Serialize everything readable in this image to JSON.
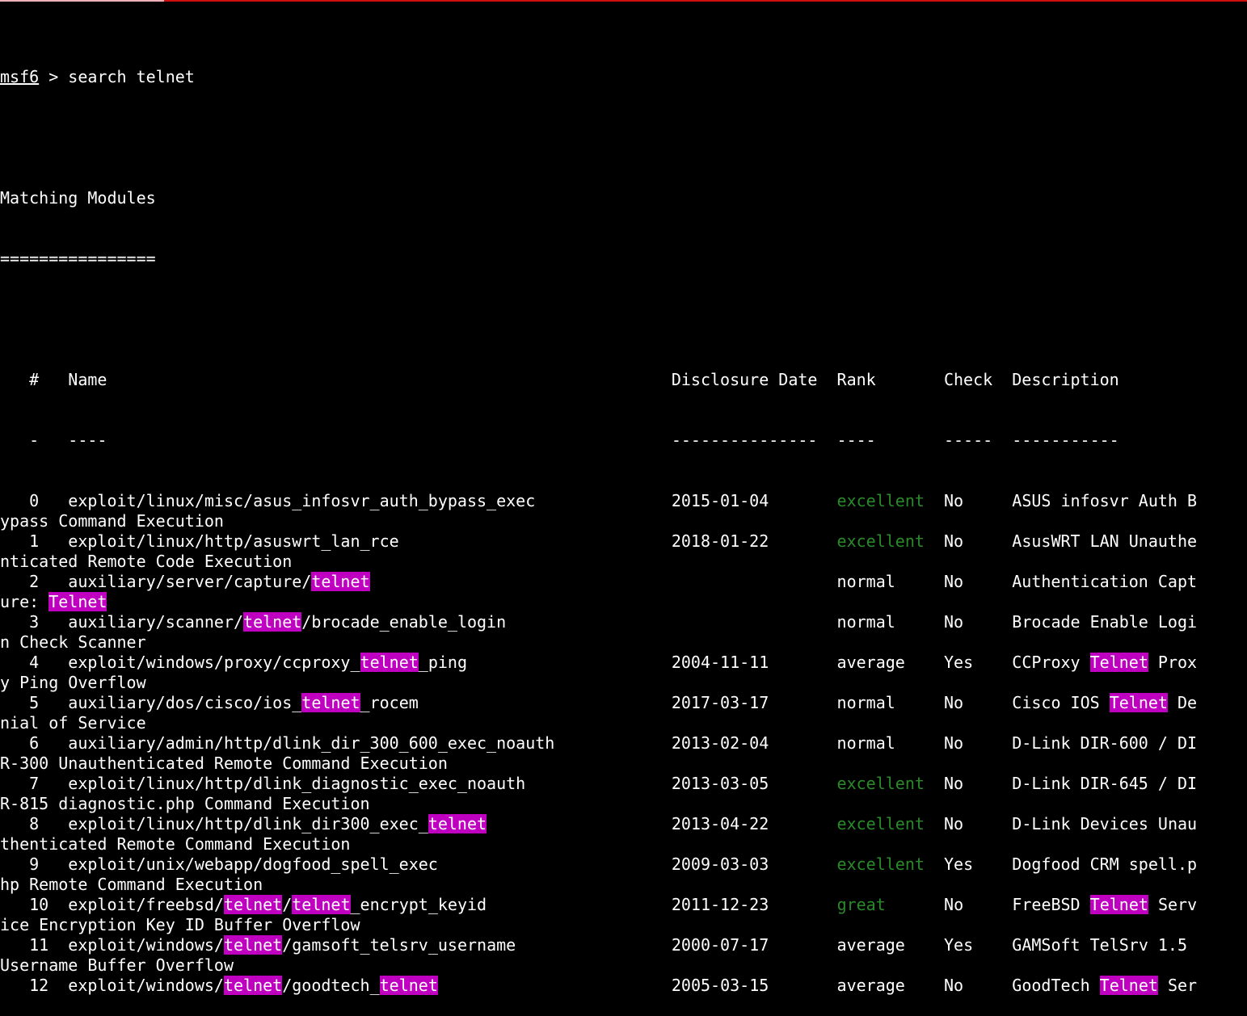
{
  "prompt": {
    "context": "msf6",
    "separator": " > ",
    "command": "search telnet"
  },
  "heading": {
    "title": "Matching Modules",
    "underline": "================"
  },
  "highlight_term": "telnet",
  "rank_green": [
    "excellent",
    "great"
  ],
  "colors": {
    "background": "#000000",
    "text": "#ffffff",
    "highlight_bg": "#c000c0",
    "rank_good": "#2a8a2a"
  },
  "header_line": "   #   Name                                                          Disclosure Date  Rank       Check  Description",
  "dash_line": "   -   ----                                                          ---------------  ----       -----  -----------",
  "rows": [
    {
      "id": 0,
      "rank": "excellent",
      "line1": "   0   exploit/linux/misc/asus_infosvr_auth_bypass_exec              2015-01-04       excellent  No     ASUS infosvr Auth B",
      "line2": "ypass Command Execution"
    },
    {
      "id": 1,
      "rank": "excellent",
      "line1": "   1   exploit/linux/http/asuswrt_lan_rce                            2018-01-22       excellent  No     AsusWRT LAN Unauthe",
      "line2": "nticated Remote Code Execution"
    },
    {
      "id": 2,
      "rank": "normal",
      "line1": "   2   auxiliary/server/capture/telnet                                                normal     No     Authentication Capt",
      "line2": "ure: Telnet"
    },
    {
      "id": 3,
      "rank": "normal",
      "line1": "   3   auxiliary/scanner/telnet/brocade_enable_login                                  normal     No     Brocade Enable Logi",
      "line2": "n Check Scanner"
    },
    {
      "id": 4,
      "rank": "average",
      "line1": "   4   exploit/windows/proxy/ccproxy_telnet_ping                     2004-11-11       average    Yes    CCProxy Telnet Prox",
      "line2": "y Ping Overflow"
    },
    {
      "id": 5,
      "rank": "normal",
      "line1": "   5   auxiliary/dos/cisco/ios_telnet_rocem                          2017-03-17       normal     No     Cisco IOS Telnet De",
      "line2": "nial of Service"
    },
    {
      "id": 6,
      "rank": "normal",
      "line1": "   6   auxiliary/admin/http/dlink_dir_300_600_exec_noauth            2013-02-04       normal     No     D-Link DIR-600 / DI",
      "line2": "R-300 Unauthenticated Remote Command Execution"
    },
    {
      "id": 7,
      "rank": "excellent",
      "line1": "   7   exploit/linux/http/dlink_diagnostic_exec_noauth               2013-03-05       excellent  No     D-Link DIR-645 / DI",
      "line2": "R-815 diagnostic.php Command Execution"
    },
    {
      "id": 8,
      "rank": "excellent",
      "line1": "   8   exploit/linux/http/dlink_dir300_exec_telnet                   2013-04-22       excellent  No     D-Link Devices Unau",
      "line2": "thenticated Remote Command Execution"
    },
    {
      "id": 9,
      "rank": "excellent",
      "line1": "   9   exploit/unix/webapp/dogfood_spell_exec                        2009-03-03       excellent  Yes    Dogfood CRM spell.p",
      "line2": "hp Remote Command Execution"
    },
    {
      "id": 10,
      "rank": "great",
      "line1": "   10  exploit/freebsd/telnet/telnet_encrypt_keyid                   2011-12-23       great      No     FreeBSD Telnet Serv",
      "line2": "ice Encryption Key ID Buffer Overflow"
    },
    {
      "id": 11,
      "rank": "average",
      "line1": "   11  exploit/windows/telnet/gamsoft_telsrv_username                2000-07-17       average    Yes    GAMSoft TelSrv 1.5 ",
      "line2": "Username Buffer Overflow"
    },
    {
      "id": 12,
      "rank": "average",
      "line1": "   12  exploit/windows/telnet/goodtech_telnet                        2005-03-15       average    No     GoodTech Telnet Ser",
      "line2": null
    }
  ]
}
